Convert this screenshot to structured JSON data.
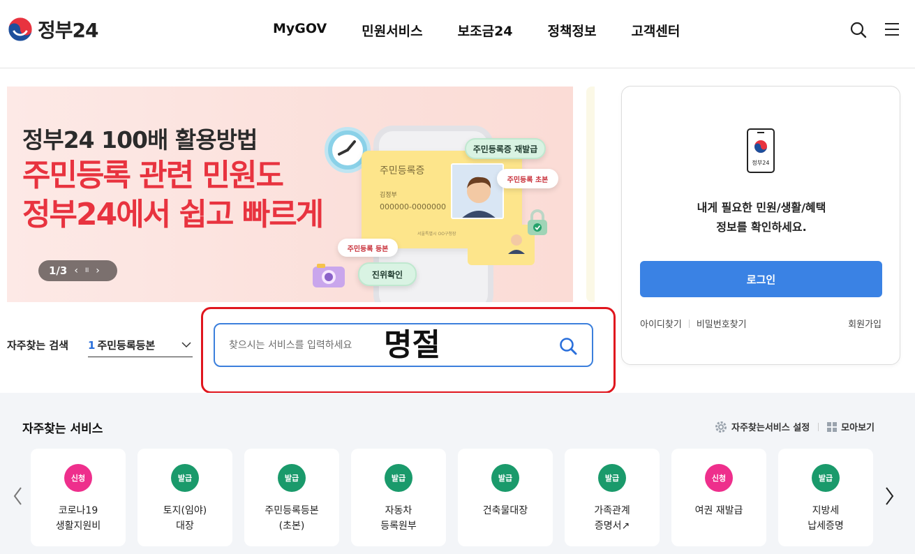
{
  "header": {
    "logo_text": "정부24",
    "nav": [
      "MyGOV",
      "민원서비스",
      "보조금24",
      "정책정보",
      "고객센터"
    ],
    "icons": [
      "search-icon",
      "menu-icon"
    ]
  },
  "banner": {
    "subtitle": "정부24 100배 활용방법",
    "title_line1": "주민등록 관련 민원도",
    "title_line2": "정부24에서 쉽고 빠르게",
    "pager": {
      "current": "1/3",
      "prev": "‹",
      "pause": "II",
      "next": "›"
    },
    "card": {
      "title": "주민등록증",
      "name": "김정부",
      "number": "000000-0000000",
      "address": "서울특별시 OO구청장"
    },
    "chips": [
      "주민등록증 재발급",
      "주민등록 초본",
      "주민등록 등본",
      "진위확인"
    ]
  },
  "frequent_search": {
    "label": "자주찾는 검색",
    "rank": "1",
    "keyword": "주민등록등본"
  },
  "search": {
    "placeholder": "찾으시는 서비스를 입력하세요",
    "typed_text": "명절"
  },
  "login": {
    "phone_label": "정부24",
    "message_line1": "내게 필요한 민원/생활/혜택",
    "message_line2": "정보를 확인하세요.",
    "login_button": "로그인",
    "find_id": "아이디찾기",
    "find_pw": "비밀번호찾기",
    "join": "회원가입"
  },
  "services": {
    "title": "자주찾는 서비스",
    "settings_label": "자주찾는서비스 설정",
    "view_all_label": "모아보기",
    "colors": {
      "apply": "#ee2f8c",
      "issue": "#1a9a6b"
    },
    "items": [
      {
        "badge": "신청",
        "type": "apply",
        "name": "코로나19\n생활지원비"
      },
      {
        "badge": "발급",
        "type": "issue",
        "name": "토지(임야)\n대장"
      },
      {
        "badge": "발급",
        "type": "issue",
        "name": "주민등록등본\n(초본)"
      },
      {
        "badge": "발급",
        "type": "issue",
        "name": "자동차\n등록원부"
      },
      {
        "badge": "발급",
        "type": "issue",
        "name": "건축물대장"
      },
      {
        "badge": "발급",
        "type": "issue",
        "name": "가족관계\n증명서↗"
      },
      {
        "badge": "신청",
        "type": "apply",
        "name": "여권 재발급"
      },
      {
        "badge": "발급",
        "type": "issue",
        "name": "지방세\n납세증명"
      }
    ]
  }
}
